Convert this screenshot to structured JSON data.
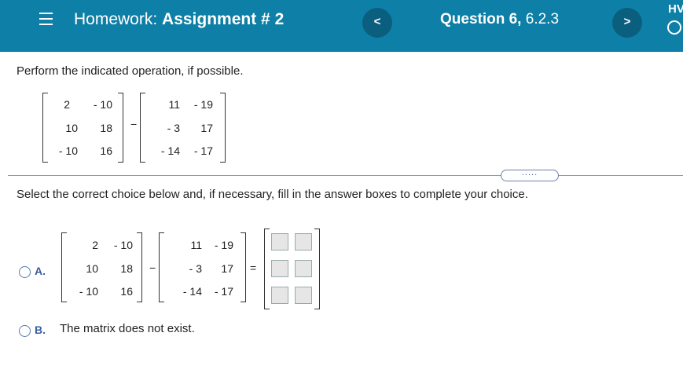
{
  "header": {
    "title_prefix": "Homework: ",
    "title_bold": "Assignment # 2",
    "prev_label": "<",
    "next_label": ">",
    "question_bold": "Question 6,",
    "question_rest": " 6.2.3",
    "corner_text": "HV"
  },
  "prompt": "Perform the indicated operation, if possible.",
  "problem": {
    "matrix_a": [
      [
        "2",
        "- 10"
      ],
      [
        "10",
        "18"
      ],
      [
        "- 10",
        "16"
      ]
    ],
    "operator": "−",
    "matrix_b": [
      [
        "11",
        "- 19"
      ],
      [
        "- 3",
        "17"
      ],
      [
        "- 14",
        "- 17"
      ]
    ]
  },
  "more_button": ".....",
  "instruction": "Select the correct choice below and, if necessary, fill in the answer boxes to complete your choice.",
  "choices": {
    "a": {
      "letter": "A.",
      "matrix_a": [
        [
          "2",
          "- 10"
        ],
        [
          "10",
          "18"
        ],
        [
          "- 10",
          "16"
        ]
      ],
      "operator": "−",
      "matrix_b": [
        [
          "11",
          "- 19"
        ],
        [
          "- 3",
          "17"
        ],
        [
          "- 14",
          "- 17"
        ]
      ],
      "equals": "="
    },
    "b": {
      "letter": "B.",
      "text": "The matrix does not exist."
    }
  },
  "colors": {
    "header": "#0e7fa6",
    "nav_button": "#0a5f7f",
    "choice_letter": "#3a5da0"
  }
}
